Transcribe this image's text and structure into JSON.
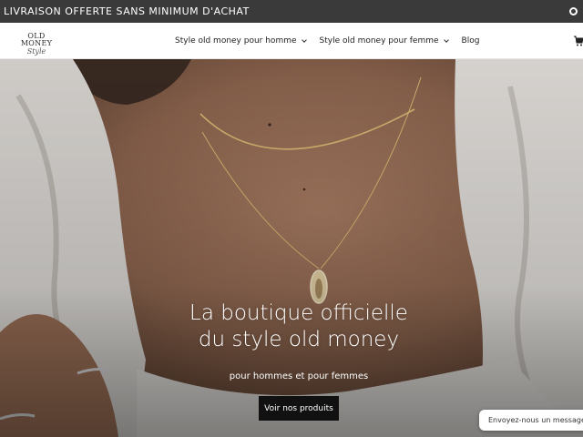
{
  "announcement": {
    "text": "LIVRAISON OFFERTE SANS MINIMUM D'ACHAT",
    "icon": "currency-icon"
  },
  "header": {
    "logo": {
      "line1": "OLD MONEY",
      "line2": "Style"
    },
    "nav": [
      {
        "label": "Style old money pour homme",
        "has_dropdown": true
      },
      {
        "label": "Style old money pour femme",
        "has_dropdown": true
      },
      {
        "label": "Blog",
        "has_dropdown": false
      }
    ],
    "cart_icon": "cart-icon"
  },
  "hero": {
    "title": "La boutique officielle du style old money",
    "subtitle": "pour hommes et pour femmes",
    "button_label": "Voir nos produits"
  },
  "chat": {
    "label": "Envoyez-nous un message",
    "status_color": "#3d7be0"
  },
  "colors": {
    "announcement_bg": "#3a3a3a",
    "button_bg": "#111111",
    "text_dark": "#222222"
  }
}
